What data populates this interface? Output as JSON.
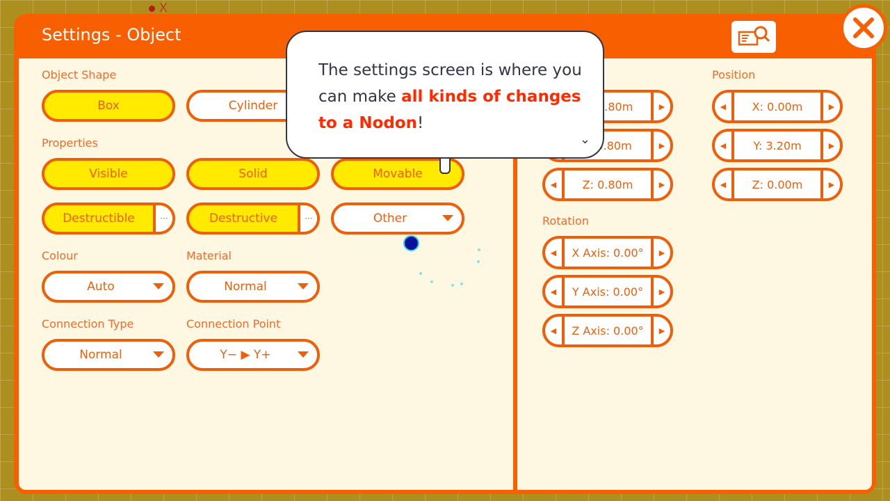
{
  "background": {
    "axis_label": "X"
  },
  "header": {
    "title": "Settings - Object",
    "help_icon": "manual-search-icon",
    "close_icon": "close-icon"
  },
  "left": {
    "object_shape": {
      "label": "Object Shape",
      "options": [
        {
          "label": "Box",
          "selected": true
        },
        {
          "label": "Cylinder",
          "selected": false
        }
      ]
    },
    "properties": {
      "label": "Properties",
      "toggles": [
        {
          "label": "Visible",
          "on": true
        },
        {
          "label": "Solid",
          "on": true
        },
        {
          "label": "Movable",
          "on": true
        }
      ],
      "extras": [
        {
          "label": "Destructible",
          "on": true,
          "more": "···"
        },
        {
          "label": "Destructive",
          "on": true,
          "more": "···"
        }
      ],
      "other": "Other"
    },
    "colour": {
      "label": "Colour",
      "value": "Auto"
    },
    "material": {
      "label": "Material",
      "value": "Normal"
    },
    "connection_type": {
      "label": "Connection Type",
      "value": "Normal"
    },
    "connection_point": {
      "label": "Connection Point",
      "value": "Y− ▶ Y+"
    }
  },
  "right": {
    "scale": {
      "values": [
        "X: 0.80m",
        "Y: 0.80m",
        "Z: 0.80m"
      ]
    },
    "position": {
      "label": "Position",
      "values": [
        "X: 0.00m",
        "Y: 3.20m",
        "Z: 0.00m"
      ]
    },
    "rotation": {
      "label": "Rotation",
      "values": [
        "X Axis: 0.00°",
        "Y Axis: 0.00°",
        "Z Axis: 0.00°"
      ]
    }
  },
  "tooltip": {
    "text_before": "The settings screen is where you can make ",
    "highlight": "all kinds of changes to a Nodon",
    "text_after": "!"
  },
  "colors": {
    "accent": "#f75f00",
    "panel_bg": "#fef8e2",
    "selected": "#ffea00",
    "highlight": "#ff2a00"
  }
}
